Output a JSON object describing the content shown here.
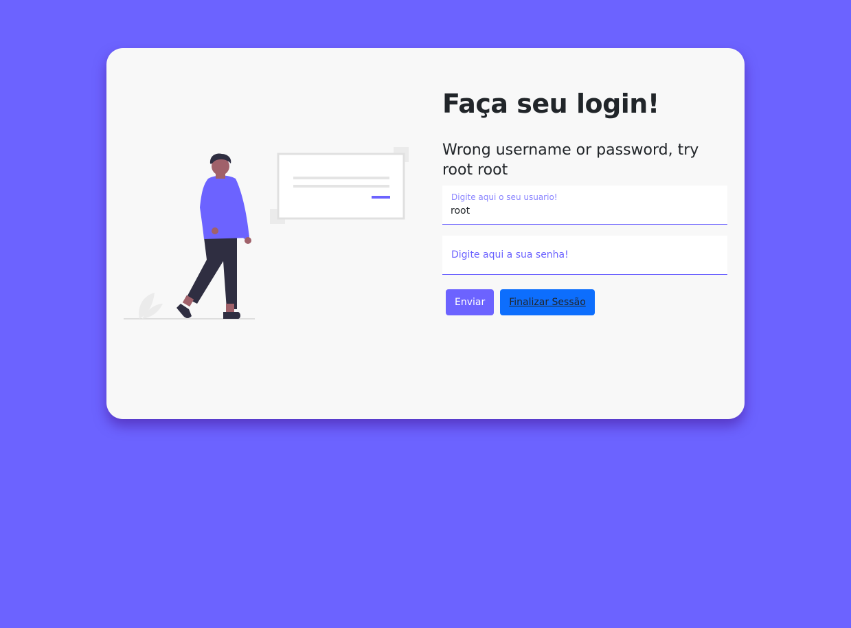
{
  "page": {
    "background_color": "#6c63ff",
    "accent_color": "#6c63ff"
  },
  "login": {
    "title": "Faça seu login!",
    "error_message": "Wrong username or password, try root root",
    "username": {
      "label": "Digite aqui o seu usuario!",
      "value": "root"
    },
    "password": {
      "placeholder": "Digite aqui a sua senha!",
      "value": ""
    },
    "buttons": {
      "submit_label": "Enviar",
      "logout_label": "Finalizar Sessão",
      "logout_color": "#0d6efd"
    }
  },
  "illustration": {
    "icon": "person-walking-login-illustration"
  }
}
